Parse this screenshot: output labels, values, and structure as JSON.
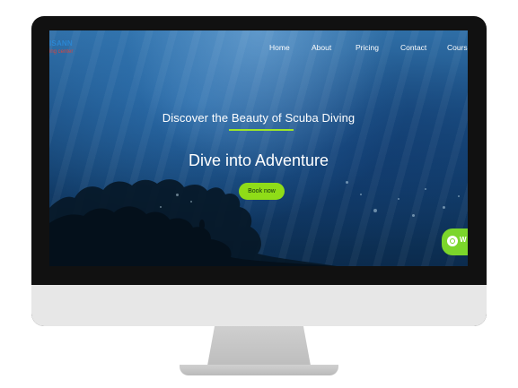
{
  "brand": {
    "name": "ISANN",
    "tagline": "ing center"
  },
  "nav": {
    "items": [
      "Home",
      "About",
      "Pricing",
      "Contact",
      "Cours"
    ]
  },
  "hero": {
    "subtitle": "Discover the Beauty of Scuba Diving",
    "title": "Dive into Adventure",
    "button_label": "Book now"
  },
  "whatsapp": {
    "label": "W"
  },
  "colors": {
    "accent": "#8fdc18",
    "accent_underline": "#9ce52a",
    "whatsapp_bg": "#7bd62b",
    "monitor_bezel": "#111111",
    "monitor_chin": "#e7e7e7",
    "ocean_dark": "#0b2b4d",
    "ocean_light": "#2f6ea6",
    "brand_name": "#2b86d2",
    "brand_tagline": "#d8453f"
  },
  "icons": {
    "whatsapp": "whatsapp-icon"
  }
}
